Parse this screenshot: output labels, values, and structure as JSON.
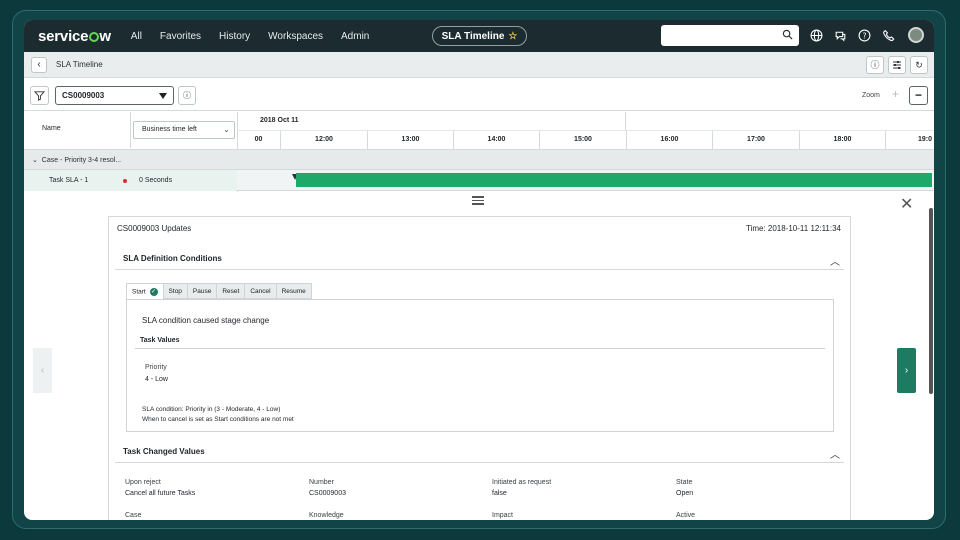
{
  "nav": {
    "logo": "servicenow",
    "links": [
      "All",
      "Favorites",
      "History",
      "Workspaces",
      "Admin"
    ],
    "pill_title": "SLA Timeline",
    "search_placeholder": ""
  },
  "subheader": {
    "title": "SLA Timeline"
  },
  "filter": {
    "record": "CS0009003",
    "zoom_label": "Zoom"
  },
  "timeline": {
    "name_header": "Name",
    "business_select": "Business time left",
    "date": "2018 Oct 11",
    "hours": [
      "00",
      "12:00",
      "13:00",
      "14:00",
      "15:00",
      "16:00",
      "17:00",
      "18:00",
      "19:0"
    ],
    "group_row": "Case - Priority 3-4 resol...",
    "task_name": "Task SLA - 1",
    "task_value": "0 Seconds"
  },
  "card": {
    "title": "CS0009003 Updates",
    "time": "Time: 2018-10-11 12:11:34",
    "sla_section": "SLA Definition Conditions",
    "tabs": [
      "Start",
      "Stop",
      "Pause",
      "Reset",
      "Cancel",
      "Resume"
    ],
    "desc": "SLA condition caused stage change",
    "task_values": "Task Values",
    "priority_label": "Priority",
    "priority_value": "4 - Low",
    "cond1": "SLA condition:  Priority in (3 - Moderate, 4 - Low)",
    "cond2": "When to cancel is set as Start conditions are not met",
    "changed_section": "Task Changed Values",
    "fields": [
      {
        "label": "Upon reject",
        "value": "Cancel all future Tasks"
      },
      {
        "label": "Number",
        "value": "CS0009003"
      },
      {
        "label": "Initiated as request",
        "value": "false"
      },
      {
        "label": "State",
        "value": "Open"
      },
      {
        "label": "Case",
        "value": ""
      },
      {
        "label": "Knowledge",
        "value": ""
      },
      {
        "label": "Impact",
        "value": ""
      },
      {
        "label": "Active",
        "value": ""
      }
    ]
  },
  "colors": {
    "nav_bg": "#1b2b2f",
    "accent_green": "#1ea86a",
    "logo_green": "#62d84e"
  }
}
